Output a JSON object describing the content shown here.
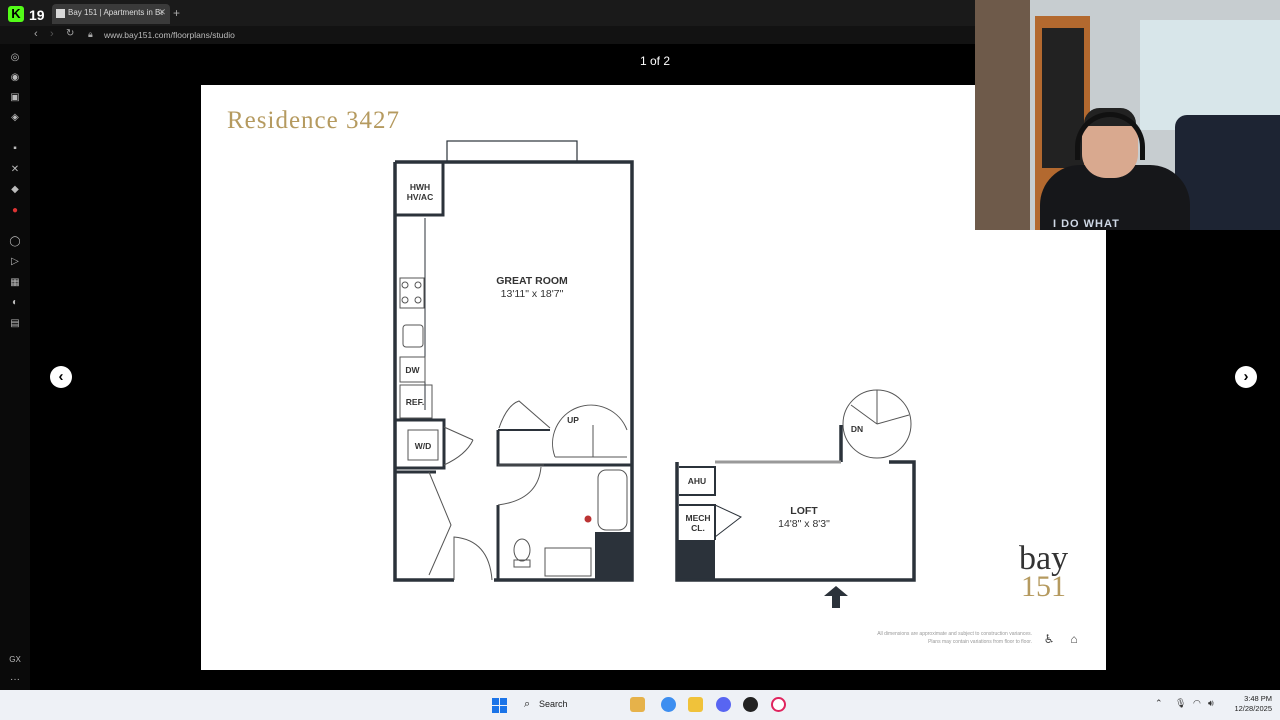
{
  "browser": {
    "app_badge": "19",
    "tab_title": "Bay 151 | Apartments in Bel",
    "url": "www.bay151.com/floorplans/studio",
    "sidebar_icons": [
      "whatsapp-icon",
      "discord-icon",
      "messenger-icon",
      "instagram-icon",
      "twitch-icon",
      "x-icon",
      "bitwarden-icon",
      "extension-icon",
      "player-icon",
      "send-icon",
      "map-icon",
      "speaker-icon",
      "calendar-icon",
      "gx-icon",
      "more-icon"
    ]
  },
  "viewer": {
    "counter": "1 of 2"
  },
  "floorplan": {
    "title": "Residence 3427",
    "great_room": {
      "name": "GREAT ROOM",
      "dims": "13'11\" x 18'7\""
    },
    "loft": {
      "name": "LOFT",
      "dims": "14'8\" x 8'3\""
    },
    "labels": {
      "hwh": "HWH",
      "hvac": "HV/AC",
      "dw": "DW",
      "ref": "REF.",
      "wd": "W/D",
      "up": "UP",
      "dn": "DN",
      "ahu": "AHU",
      "mech": "MECH",
      "cl": "CL."
    },
    "brand_word": "bay",
    "brand_number": "151",
    "disclaimer_1": "All dimensions are approximate and subject to construction variances.",
    "disclaimer_2": "Plans may contain variations from floor to floor."
  },
  "webcam": {
    "shirt_text": "I DO WHAT"
  },
  "taskbar": {
    "search_label": "Search",
    "time": "3:48 PM",
    "date": "12/28/2025"
  },
  "colors": {
    "accent_gold": "#b59a5f",
    "wall": "#2b323a",
    "kick_green": "#53fc18"
  }
}
